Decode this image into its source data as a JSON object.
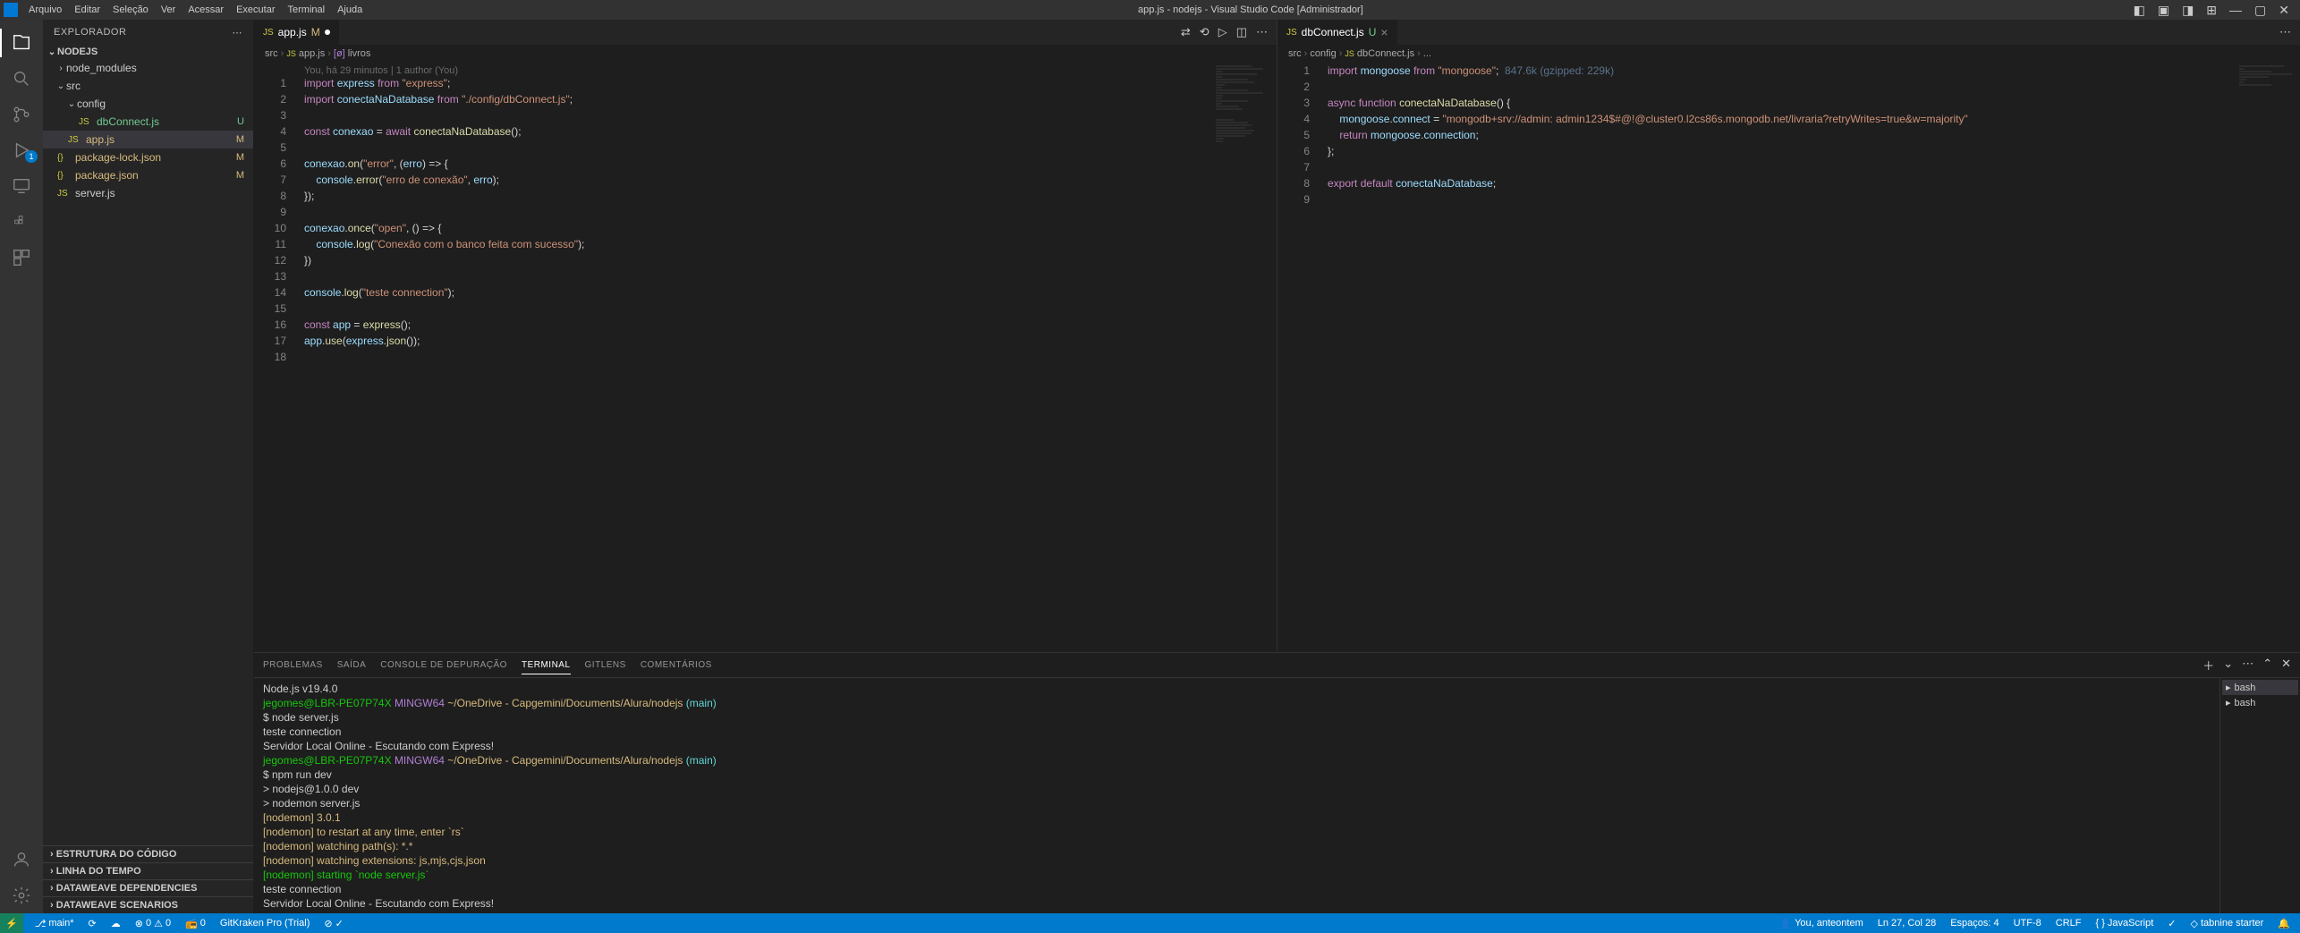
{
  "title": "app.js - nodejs - Visual Studio Code [Administrador]",
  "menu": [
    "Arquivo",
    "Editar",
    "Seleção",
    "Ver",
    "Acessar",
    "Executar",
    "Terminal",
    "Ajuda"
  ],
  "activity": {
    "scm_badge": "1"
  },
  "sidebar": {
    "title": "EXPLORADOR",
    "root": "NODEJS",
    "tree": {
      "node_modules": "node_modules",
      "src": "src",
      "config": "config",
      "dbconnect": "dbConnect.js",
      "app": "app.js",
      "pkg_lock": "package-lock.json",
      "pkg": "package.json",
      "server": "server.js"
    },
    "status": {
      "dbconnect": "U",
      "app": "M",
      "pkg_lock": "M",
      "pkg": "M"
    },
    "sections": [
      "ESTRUTURA DO CÓDIGO",
      "LINHA DO TEMPO",
      "DATAWEAVE DEPENDENCIES",
      "DATAWEAVE SCENARIOS"
    ]
  },
  "editor1": {
    "tab": "app.js",
    "tab_status": "M",
    "breadcrumb": [
      "src",
      "app.js",
      "livros"
    ],
    "blame": "You, há 29 minutos | 1 author (You)",
    "lines": 18
  },
  "editor2": {
    "tab": "dbConnect.js",
    "tab_status": "U",
    "breadcrumb": [
      "src",
      "config",
      "dbConnect.js",
      "..."
    ],
    "gzip": "847.6k (gzipped: 229k)",
    "lines": 9
  },
  "panel": {
    "tabs": [
      "PROBLEMAS",
      "SAÍDA",
      "CONSOLE DE DEPURAÇÃO",
      "TERMINAL",
      "GITLENS",
      "COMENTÁRIOS"
    ],
    "active_tab": 3,
    "term_label": "bash",
    "terminal": {
      "node_version": "Node.js v19.4.0",
      "prompt_user": "jegomes@LBR-PE07P74X",
      "prompt_sys": "MINGW64",
      "prompt_path": "~/OneDrive - Capgemini/Documents/Alura/nodejs",
      "prompt_branch": "(main)",
      "cmd1": "$ node server.js",
      "out1a": "teste connection",
      "out1b": "Servidor Local Online - Escutando com Express!",
      "cmd2": "$ npm run dev",
      "out2a": "> nodejs@1.0.0 dev",
      "out2b": "> nodemon server.js",
      "nm1": "[nodemon] 3.0.1",
      "nm2": "[nodemon] to restart at any time, enter `rs`",
      "nm3": "[nodemon] watching path(s): *.*",
      "nm4": "[nodemon] watching extensions: js,mjs,cjs,json",
      "nm5": "[nodemon] starting `node server.js`",
      "out3a": "teste connection",
      "out3b": "Servidor Local Online - Escutando com Express!",
      "cursor": "▯"
    }
  },
  "status": {
    "branch": "main*",
    "sync": "⟳",
    "errors": "0",
    "warnings": "0",
    "port": "0",
    "gitkraken": "GitKraken Pro (Trial)",
    "blame": "You, anteontem",
    "cursor": "Ln 27, Col 28",
    "spaces": "Espaços: 4",
    "encoding": "UTF-8",
    "eol": "CRLF",
    "lang": "JavaScript",
    "tabnine": "tabnine starter"
  }
}
